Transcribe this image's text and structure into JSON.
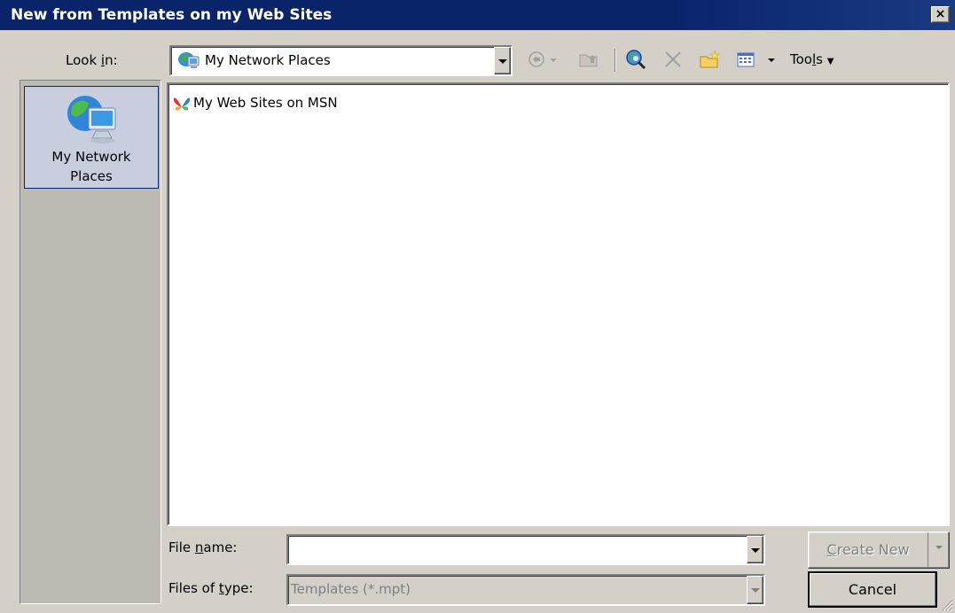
{
  "window": {
    "title": "New from Templates on my Web Sites",
    "close_glyph": "×"
  },
  "look_in": {
    "label_pre": "Look ",
    "label_key": "i",
    "label_post": "n:",
    "value": "My Network Places",
    "icon": "network-places-icon"
  },
  "toolbar": {
    "tools_pre": "Too",
    "tools_key": "l",
    "tools_post": "s",
    "icons": [
      "back-icon",
      "up-folder-icon",
      "search-web-icon",
      "delete-icon",
      "new-folder-icon",
      "views-icon"
    ]
  },
  "places_bar": {
    "items": [
      {
        "label": "My Network\nPlaces",
        "icon": "network-globe-computer-icon"
      }
    ]
  },
  "file_list": {
    "items": [
      {
        "name": "My Web Sites on MSN",
        "icon": "msn-butterfly-icon"
      }
    ]
  },
  "file_name": {
    "label_pre": "File ",
    "label_key": "n",
    "label_post": "ame:",
    "value": "",
    "placeholder": ""
  },
  "files_of_type": {
    "label_pre": "Files of ",
    "label_key": "t",
    "label_post": "ype:",
    "value": "Templates (*.mpt)"
  },
  "buttons": {
    "create_new_key": "C",
    "create_new_rest": "reate New",
    "cancel": "Cancel"
  }
}
